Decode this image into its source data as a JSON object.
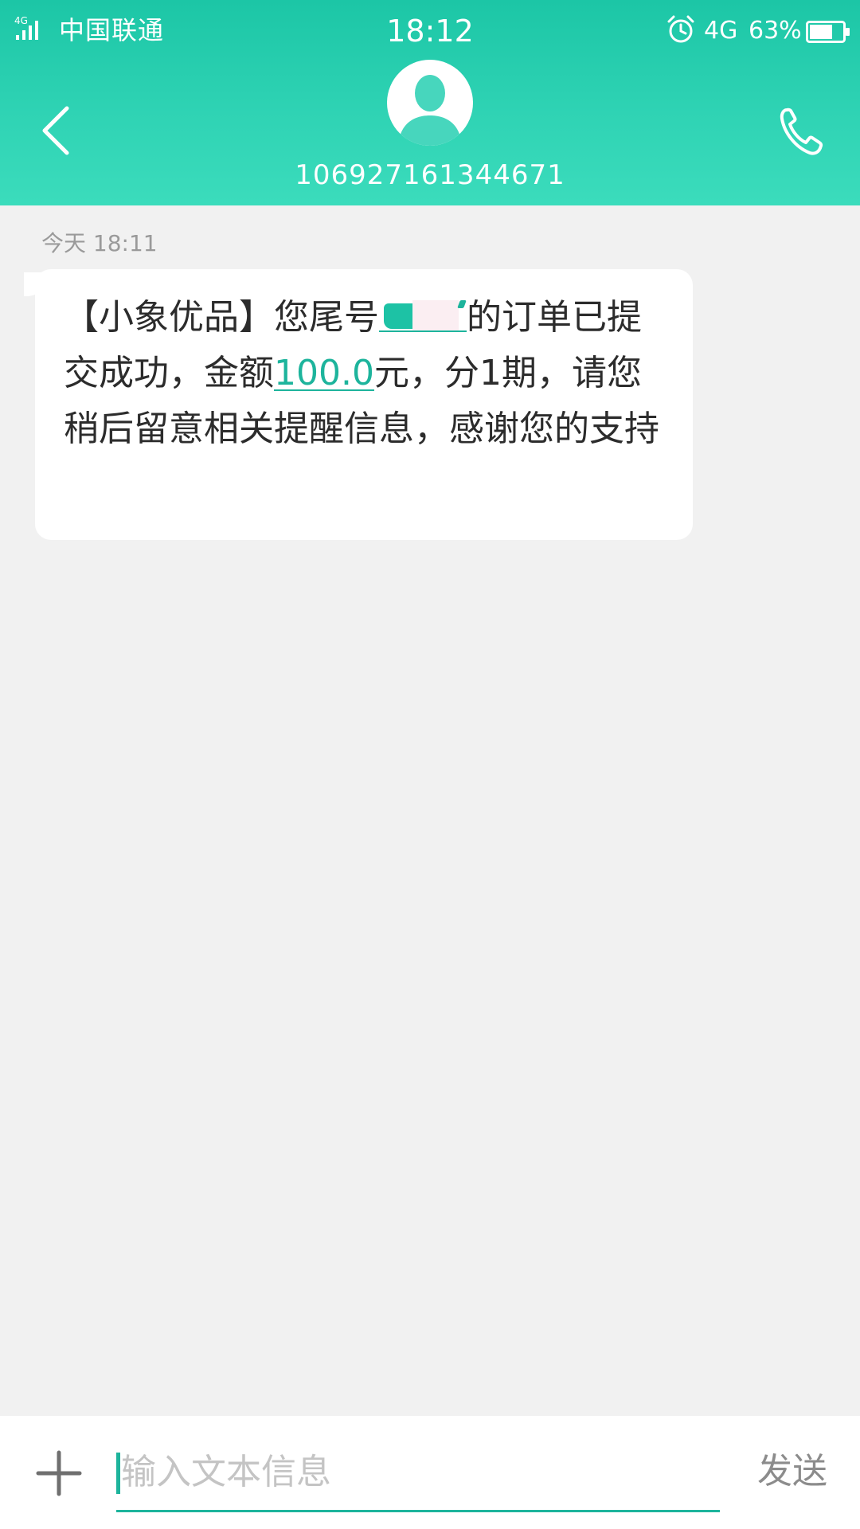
{
  "status_bar": {
    "network_badge": "4G",
    "carrier": "中国联通",
    "time": "18:12",
    "network_type": "4G",
    "battery": "63%"
  },
  "header": {
    "contact_number": "106927161344671"
  },
  "conversation": {
    "timestamp": "今天 18:11",
    "message": {
      "part1": "【小象优品】您尾号",
      "part2": "的订单已提交成功，金额",
      "amount": "100.0",
      "part3": "元，分1期，请您稍后留意相关提醒信息，感谢您的支持"
    }
  },
  "composer": {
    "placeholder": "输入文本信息",
    "send_label": "发送"
  },
  "colors": {
    "header_accent": "#1cc6a6",
    "link": "#1db49c",
    "background": "#f1f1f1"
  }
}
